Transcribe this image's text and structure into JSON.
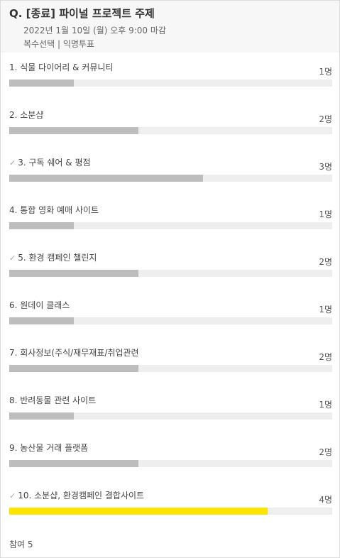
{
  "poll": {
    "title": "Q. [종료] 파이널 프로젝트 주제",
    "deadline": "2022년 1월 10일 (월) 오후 9:00 마감",
    "mode": "복수선택 | 익명투표",
    "participants": "참여 5",
    "total_voters": 5,
    "options": [
      {
        "label": "1. 식물 다이어리 & 커뮤니티",
        "count": "1명",
        "votes": 1,
        "checked": false,
        "top": false
      },
      {
        "label": "2. 소분샵",
        "count": "2명",
        "votes": 2,
        "checked": false,
        "top": false
      },
      {
        "label": "3.  구독 쉐어 & 평점",
        "count": "3명",
        "votes": 3,
        "checked": true,
        "top": false
      },
      {
        "label": "4. 통합 영화 예매 사이트",
        "count": "1명",
        "votes": 1,
        "checked": false,
        "top": false
      },
      {
        "label": "5. 환경 캠페인 챌린지",
        "count": "2명",
        "votes": 2,
        "checked": true,
        "top": false
      },
      {
        "label": "6. 원데이 클래스",
        "count": "1명",
        "votes": 1,
        "checked": false,
        "top": false
      },
      {
        "label": "7. 회사정보(주식/재무재표/취업관련",
        "count": "2명",
        "votes": 2,
        "checked": false,
        "top": false
      },
      {
        "label": "8.  반려동물 관련 사이트",
        "count": "1명",
        "votes": 1,
        "checked": false,
        "top": false
      },
      {
        "label": "9. 농산물 거래 플랫폼",
        "count": "2명",
        "votes": 2,
        "checked": false,
        "top": false
      },
      {
        "label": "10. 소분샵, 환경캠페인 결합사이트",
        "count": "4명",
        "votes": 4,
        "checked": true,
        "top": true
      }
    ]
  },
  "colors": {
    "bar_track": "#eeeeee",
    "bar_fill": "#bdbdbd",
    "bar_top": "#ffe400",
    "header_bg": "#f7f7f7"
  },
  "icons": {
    "check": "check-icon"
  }
}
